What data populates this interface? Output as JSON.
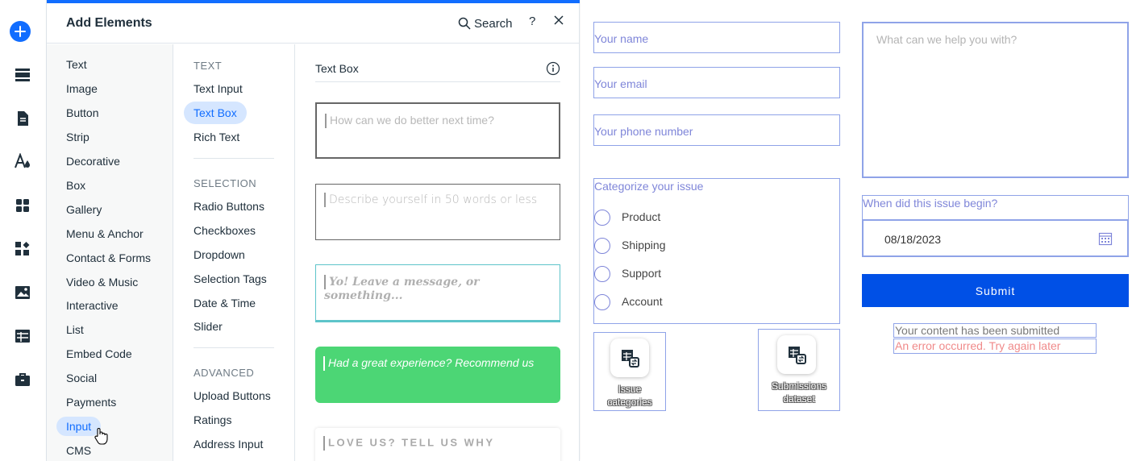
{
  "panel": {
    "title": "Add Elements",
    "search_label": "Search",
    "help_label": "?"
  },
  "categories": [
    "Text",
    "Image",
    "Button",
    "Strip",
    "Decorative",
    "Box",
    "Gallery",
    "Menu & Anchor",
    "Contact & Forms",
    "Video & Music",
    "Interactive",
    "List",
    "Embed Code",
    "Social",
    "Payments",
    "Input",
    "CMS"
  ],
  "active_category": "Input",
  "subcategories": {
    "text_heading": "TEXT",
    "text_items": [
      "Text Input",
      "Text Box",
      "Rich Text"
    ],
    "selection_heading": "SELECTION",
    "selection_items": [
      "Radio Buttons",
      "Checkboxes",
      "Dropdown",
      "Selection Tags",
      "Date & Time",
      "Slider"
    ],
    "advanced_heading": "ADVANCED",
    "advanced_items": [
      "Upload Buttons",
      "Ratings",
      "Address Input"
    ],
    "active": "Text Box"
  },
  "previews": {
    "section_title": "Text Box",
    "items": [
      "How can we do better next time?",
      "Describe yourself in 50 words or less",
      "Yo! Leave a message, or something...",
      "Had a great experience? Recommend us",
      "LOVE US? TELL US WHY"
    ]
  },
  "form": {
    "name_placeholder": "Your name",
    "email_placeholder": "Your email",
    "phone_placeholder": "Your phone number",
    "message_placeholder": "What can we help you with?",
    "radio_label": "Categorize your issue",
    "radio_options": [
      "Product",
      "Shipping",
      "Support",
      "Account"
    ],
    "date_label": "When did this issue begin?",
    "date_value": "08/18/2023",
    "submit_label": "Submit",
    "success_message": "Your content has been submitted",
    "error_message": "An error occurred. Try again later"
  },
  "datasets": [
    {
      "label_line1": "Issue",
      "label_line2": "categories"
    },
    {
      "label_line1": "Submissions",
      "label_line2": "dataset"
    }
  ],
  "colors": {
    "accent": "#116dff",
    "submit": "#0050e6",
    "field_border": "#8fa3e8",
    "green_preview": "#4cd675",
    "error": "#f08a8a"
  }
}
